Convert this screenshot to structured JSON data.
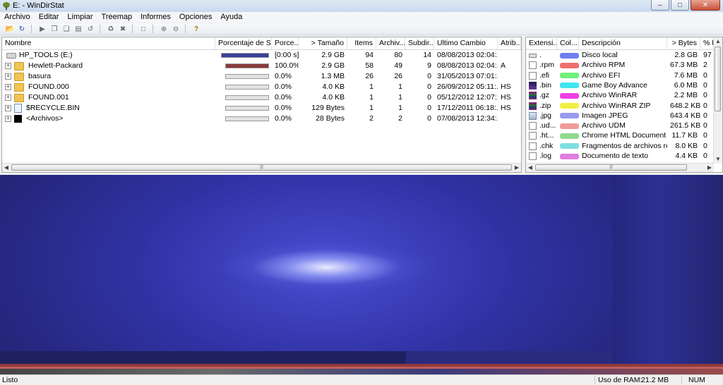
{
  "window": {
    "title": "E: - WinDirStat"
  },
  "menu": [
    "Archivo",
    "Editar",
    "Limpiar",
    "Treemap",
    "Informes",
    "Opciones",
    "Ayuda"
  ],
  "tree": {
    "columns": [
      "Nombre",
      "Porcentaje de S...",
      "Porce...",
      "> Tamaño",
      "Items",
      "Archiv...",
      "Subdir...",
      "Ultimo Cambio",
      "Atrib..."
    ],
    "rows": [
      {
        "name": "HP_TOOLS (E:)",
        "bar_fraction": 1.0,
        "bar_color": "#3a3f9a",
        "percent": "[0:00 s]",
        "size": "2.9 GB",
        "items": "94",
        "files": "80",
        "subdirs": "14",
        "modified": "08/08/2013 02:04:...",
        "attrib": ""
      },
      {
        "name": "Hewlett-Packard",
        "bar_fraction": 1.0,
        "bar_color": "#8b3a3a",
        "percent": "100.0%",
        "size": "2.9 GB",
        "items": "58",
        "files": "49",
        "subdirs": "9",
        "modified": "08/08/2013 02:04:...",
        "attrib": "A"
      },
      {
        "name": "basura",
        "bar_fraction": 0.0,
        "bar_color": "#8b3a3a",
        "percent": "0.0%",
        "size": "1.3 MB",
        "items": "26",
        "files": "26",
        "subdirs": "0",
        "modified": "31/05/2013 07:01:...",
        "attrib": ""
      },
      {
        "name": "FOUND.000",
        "bar_fraction": 0.0,
        "bar_color": "#8b3a3a",
        "percent": "0.0%",
        "size": "4.0 KB",
        "items": "1",
        "files": "1",
        "subdirs": "0",
        "modified": "26/09/2012 05:11:...",
        "attrib": "HS"
      },
      {
        "name": "FOUND.001",
        "bar_fraction": 0.0,
        "bar_color": "#8b3a3a",
        "percent": "0.0%",
        "size": "4.0 KB",
        "items": "1",
        "files": "1",
        "subdirs": "0",
        "modified": "05/12/2012 12:07:...",
        "attrib": "HS"
      },
      {
        "name": "$RECYCLE.BIN",
        "bar_fraction": 0.0,
        "bar_color": "#8b3a3a",
        "percent": "0.0%",
        "size": "129 Bytes",
        "items": "1",
        "files": "1",
        "subdirs": "0",
        "modified": "17/12/2011 06:18:...",
        "attrib": "HS"
      },
      {
        "name": "<Archivos>",
        "bar_fraction": 0.0,
        "bar_color": "#8b3a3a",
        "percent": "0.0%",
        "size": "28 Bytes",
        "items": "2",
        "files": "2",
        "subdirs": "0",
        "modified": "07/08/2013 12:34:...",
        "attrib": ""
      }
    ]
  },
  "extensions": {
    "columns": [
      "Extensi...",
      "Col...",
      "Descripción",
      "> Bytes",
      "% B..."
    ],
    "rows": [
      {
        "ext": ".",
        "color": "#6f7df0",
        "description": "Disco local",
        "bytes": "2.8 GB",
        "percent": "97"
      },
      {
        "ext": ".rpm",
        "color": "#f06f6f",
        "description": "Archivo RPM",
        "bytes": "67.3 MB",
        "percent": "2"
      },
      {
        "ext": ".efi",
        "color": "#6ff07a",
        "description": "Archivo EFI",
        "bytes": "7.6 MB",
        "percent": "0"
      },
      {
        "ext": ".bin",
        "color": "#3fe6f0",
        "description": "Game Boy Advance",
        "bytes": "6.0 MB",
        "percent": "0"
      },
      {
        "ext": ".gz",
        "color": "#f03fe6",
        "description": "Archivo WinRAR",
        "bytes": "2.2 MB",
        "percent": "0"
      },
      {
        "ext": ".zip",
        "color": "#f0f03f",
        "description": "Archivo WinRAR ZIP",
        "bytes": "648.2 KB",
        "percent": "0"
      },
      {
        "ext": ".jpg",
        "color": "#9a9af0",
        "description": "Imagen JPEG",
        "bytes": "643.4 KB",
        "percent": "0"
      },
      {
        "ext": ".ud...",
        "color": "#f09a9a",
        "description": "Archivo UDM",
        "bytes": "261.5 KB",
        "percent": "0"
      },
      {
        "ext": ".ht...",
        "color": "#8fd98f",
        "description": "Chrome HTML Document",
        "bytes": "11.7 KB",
        "percent": "0"
      },
      {
        "ext": ".chk",
        "color": "#7de0e0",
        "description": "Fragmentos de archivos rec...",
        "bytes": "8.0 KB",
        "percent": "0"
      },
      {
        "ext": ".log",
        "color": "#e07de0",
        "description": "Documento de texto",
        "bytes": "4.4 KB",
        "percent": "0"
      }
    ]
  },
  "status": {
    "text": "Listo",
    "ram_label": "Uso de RAM:",
    "ram_value": "21.2 MB",
    "num": "NUM"
  },
  "icons": {
    "toolbar": [
      "open-icon",
      "refresh-icon",
      "play-icon",
      "copy-icon",
      "copy-path-icon",
      "properties-icon",
      "refresh-selected-icon",
      "cleanup-icon",
      "delete-icon",
      "new-folder-icon",
      "zoom-in-icon",
      "zoom-out-icon",
      "help-icon"
    ]
  }
}
